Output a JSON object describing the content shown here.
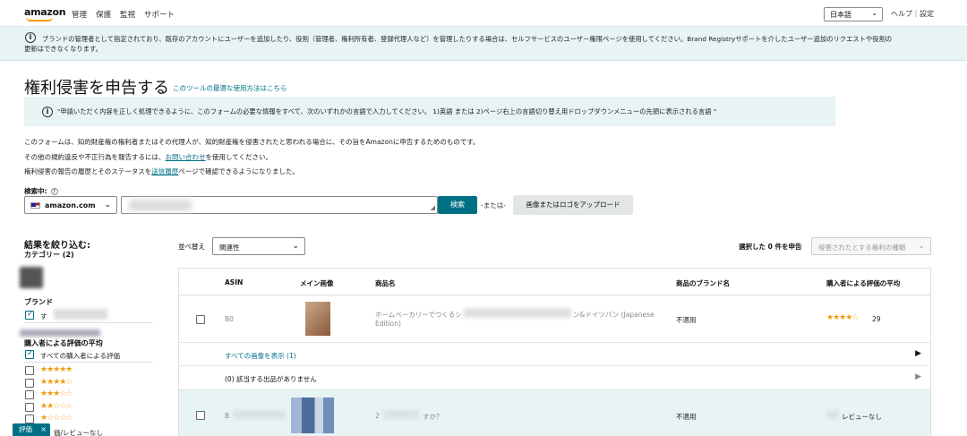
{
  "header": {
    "logo": "amazon",
    "nav": [
      "管理",
      "保護",
      "監視",
      "サポート"
    ],
    "language": "日本語",
    "help": "ヘルプ｜設定"
  },
  "banner": {
    "line1": "ブランドの管理者として指定されており、既存のアカウントにユーザーを追加したり、役割（管理者、権利所有者、登録代理人など）を管理したりする場合は、セルフサービスのユーザー権限ページを使用してください。Brand Registryサポートを介したユーザー追加のリクエストや役割の",
    "line2": "更新はできなくなります。"
  },
  "page": {
    "title": "権利侵害を申告する",
    "title_link": "このツールの最適な使用方法はこちら",
    "notice": "\"申請いただく内容を正しく処理できるように、このフォームの必要な情報をすべて、次のいずれかの言語で入力してください。 1)英語 または 2)ページ右上の言語切り替え用ドロップダウンメニューの先頭に表示される言語 \"",
    "para1": "このフォームは、知的財産権の権利者またはその代理人が、知的財産権を侵害されたと思われる場合に、その旨をAmazonに申告するためのものです。",
    "para2_pre": "その他の規約違反や不正行為を報告するには、",
    "para2_link": "お問い合わせ",
    "para2_post": "を使用してください。",
    "para3_pre": "権利侵害の報告の履歴とそのステータスを",
    "para3_link": "送信履歴",
    "para3_post": "ページで確認できるようになりました。"
  },
  "search": {
    "label": "検索中:",
    "help": "?",
    "marketplace": "amazon.com",
    "input_prefix": "",
    "button": "検索",
    "or": "-または-",
    "upload": "画像またはロゴをアップロード"
  },
  "filters": {
    "title": "結果を絞り込む:",
    "category": "カテゴリー (2)",
    "brand": "ブランド",
    "brand_all": "す",
    "rating_title": "購入者による評価の平均",
    "rating_all": "すべての購入者による評価",
    "rating_options": [
      5,
      4,
      3,
      2,
      1
    ],
    "no_rating": "価/レビューなし"
  },
  "sort": {
    "label": "並べ替え",
    "value": "関連性",
    "report": "選択した 0 件を申告",
    "rights": "侵害されたとする権利の種類"
  },
  "table": {
    "headers": [
      "ASIN",
      "メイン画像",
      "商品名",
      "商品のブランド名",
      "購入者による評価の平均"
    ],
    "rows": [
      {
        "asin": "B0",
        "title_line1": "ホームベーカリーでつくるシ",
        "title_line1b": "ン&ドイツパン (Japanese",
        "title_line2": "Edition)",
        "brand": "不適用",
        "stars": 4,
        "rating_count": "29",
        "images_link": "すべての画像を表示 (1)",
        "offers": "(0) 該当する出品がありません"
      },
      {
        "asin": "B",
        "title": "2",
        "title_tail": "すか？",
        "brand": "不適用",
        "rating": "レビューなし"
      }
    ]
  },
  "chip": {
    "label": "評価",
    "close": "×"
  },
  "colors": {
    "teal": "#007185",
    "banner_bg": "#e8f4f4",
    "star": "#f39c12"
  }
}
